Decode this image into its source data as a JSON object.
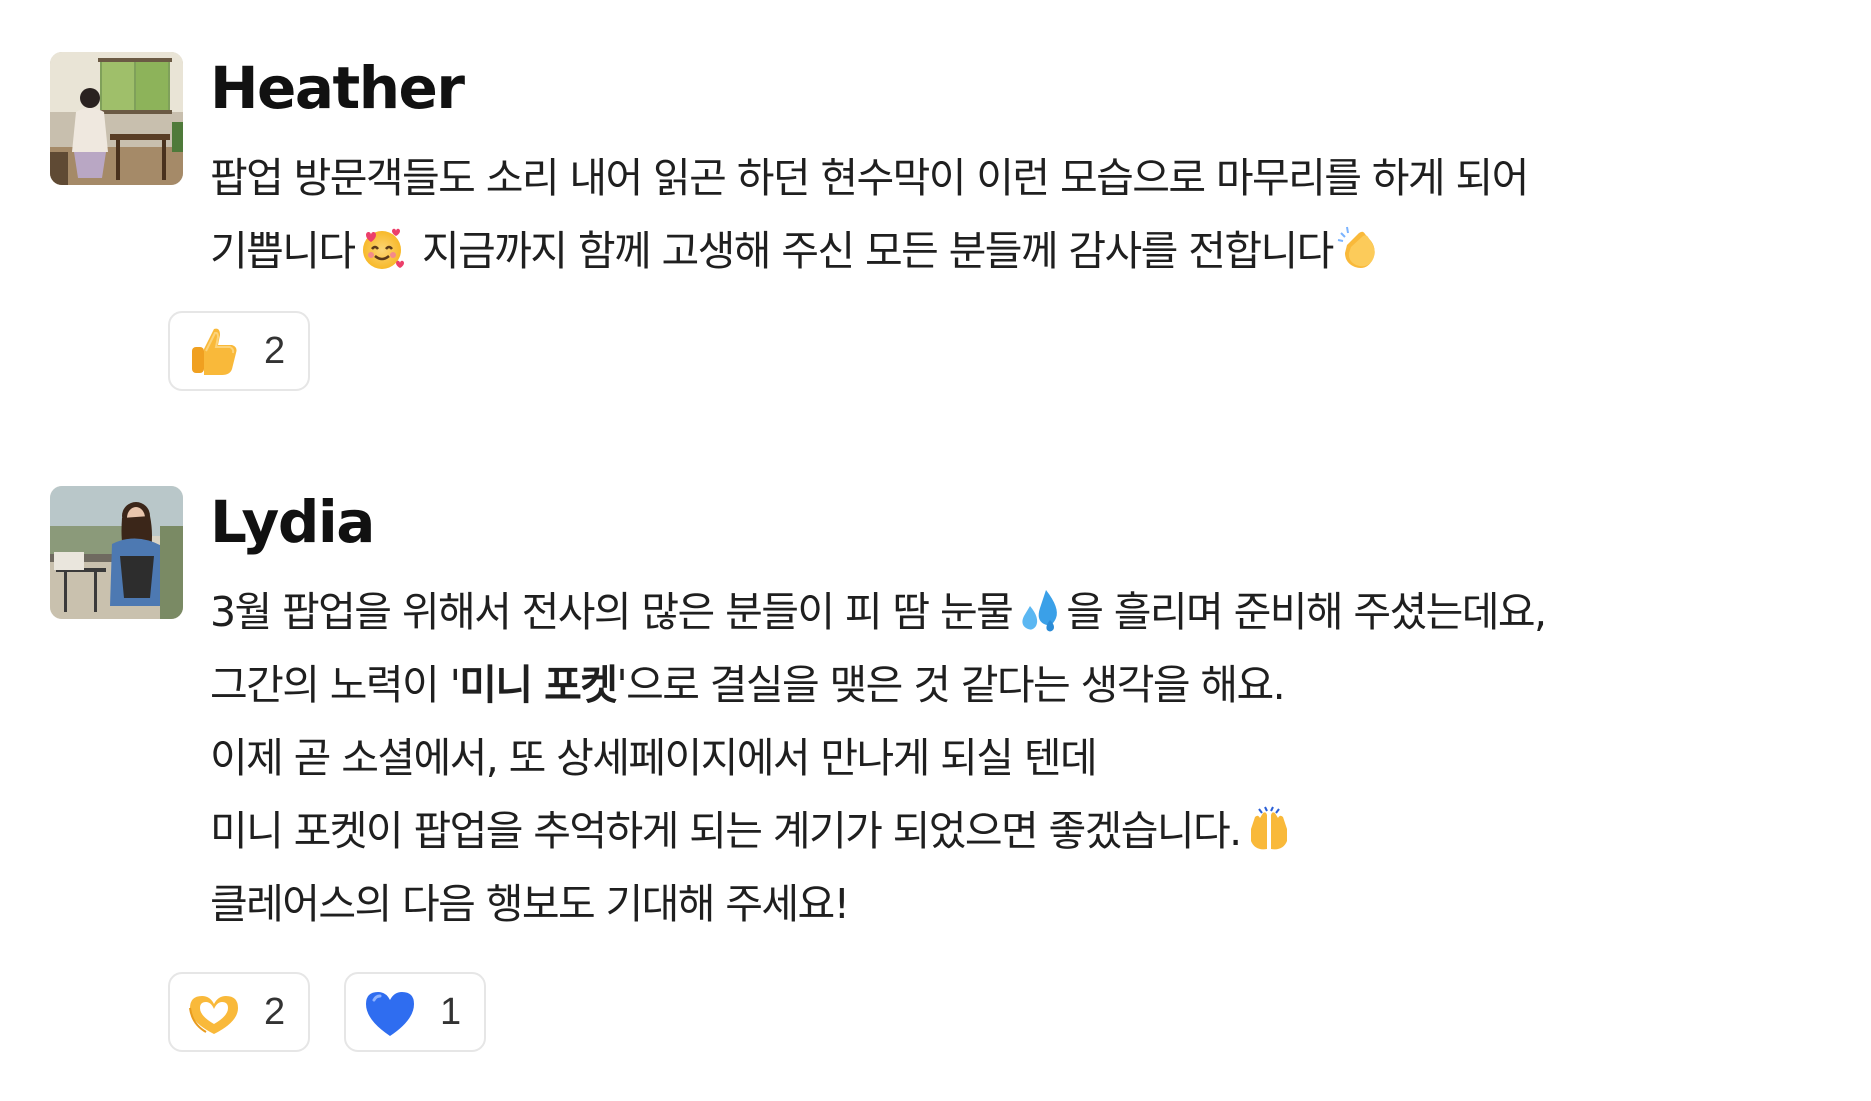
{
  "messages": [
    {
      "author": "Heather",
      "avatar_icon": "avatar-photo-cafe-window",
      "lines": [
        "팝업 방문객들도 소리 내어 읽곤 하던 현수막이 이런 모습으로 마무리를 하게 되어",
        "기쁩니다",
        "지금까지 함께 고생해 주신 모든 분들께 감사를 전합니다"
      ],
      "reactions": [
        {
          "icon": "thumbs-up-icon",
          "count": "2"
        }
      ]
    },
    {
      "author": "Lydia",
      "avatar_icon": "avatar-photo-outdoor-denim",
      "lines": [
        "3월 팝업을 위해서 전사의 많은 분들이 피 땀 눈물",
        "을 흘리며 준비해 주셨는데요,",
        "그간의 노력이 '",
        "미니 포켓",
        "'으로 결실을 맺은 것 같다는 생각을 해요.",
        "이제 곧 소셜에서, 또 상세페이지에서 만나게 되실 텐데",
        "미니 포켓이 팝업을 추억하게 되는 계기가 되었으면 좋겠습니다.",
        "클레어스의 다음 행보도 기대해 주세요!"
      ],
      "reactions": [
        {
          "icon": "heart-hands-icon",
          "count": "2"
        },
        {
          "icon": "blue-heart-icon",
          "count": "1"
        }
      ]
    }
  ],
  "colors": {
    "text": "#1f1f1f",
    "reaction_border": "#e6e6e6",
    "thumb_yellow": "#f9b93a",
    "blue_heart": "#2f6df0"
  }
}
